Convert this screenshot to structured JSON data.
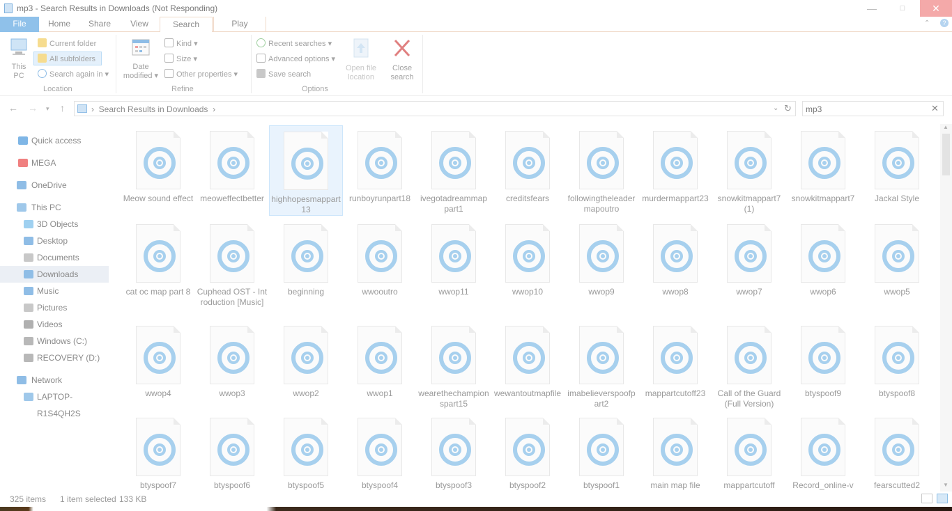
{
  "window": {
    "title": "mp3 - Search Results in Downloads (Not Responding)"
  },
  "tabs": [
    "File",
    "Home",
    "Share",
    "View",
    "Search",
    "Play"
  ],
  "ribbon": {
    "location": {
      "label": "Location",
      "this_pc": [
        "This",
        "PC"
      ],
      "current_folder": "Current folder",
      "all_subfolders": "All subfolders",
      "search_again": "Search again in"
    },
    "refine": {
      "label": "Refine",
      "date_modified": [
        "Date",
        "modified"
      ],
      "kind": "Kind",
      "size": "Size",
      "other_properties": "Other properties"
    },
    "options": {
      "label": "Options",
      "recent_searches": "Recent searches",
      "advanced_options": "Advanced options",
      "save_search": "Save search",
      "open_file_location": [
        "Open file",
        "location"
      ],
      "close_search": [
        "Close",
        "search"
      ]
    }
  },
  "address": {
    "breadcrumb": "Search Results in Downloads",
    "search_value": "mp3"
  },
  "sidebar": {
    "items": [
      {
        "label": "Quick access",
        "icon": "star-icon",
        "color": "#7fb6e6"
      },
      {
        "label": "MEGA",
        "icon": "mega-icon",
        "color": "#f08080"
      },
      {
        "label": "OneDrive",
        "icon": "cloud-icon",
        "color": "#8fbde6"
      },
      {
        "label": "This PC",
        "icon": "computer-icon",
        "color": "#9fc8ea"
      },
      {
        "label": "3D Objects",
        "icon": "cube-icon",
        "color": "#9fd0f0"
      },
      {
        "label": "Desktop",
        "icon": "desktop-icon",
        "color": "#8fbde6"
      },
      {
        "label": "Documents",
        "icon": "documents-icon",
        "color": "#c8c8c8"
      },
      {
        "label": "Downloads",
        "icon": "download-icon",
        "color": "#8fbde6"
      },
      {
        "label": "Music",
        "icon": "music-icon",
        "color": "#8fbde6"
      },
      {
        "label": "Pictures",
        "icon": "pictures-icon",
        "color": "#c8c8c8"
      },
      {
        "label": "Videos",
        "icon": "videos-icon",
        "color": "#b0b0b0"
      },
      {
        "label": "Windows (C:)",
        "icon": "drive-icon",
        "color": "#b8b8b8"
      },
      {
        "label": "RECOVERY (D:)",
        "icon": "drive-icon",
        "color": "#b8b8b8"
      },
      {
        "label": "Network",
        "icon": "network-icon",
        "color": "#8fbde6"
      },
      {
        "label": "LAPTOP-R1S4QH2S",
        "icon": "computer-icon",
        "color": "#9fc8ea"
      }
    ]
  },
  "files": [
    [
      "Meow sound effect",
      "meoweffectbetter",
      "highhopesmappart13",
      "runboyrunpart18",
      "ivegotadreammappart1",
      "creditsfears",
      "followingtheleadermapoutro",
      "murdermappart23",
      "snowkitmappart7 (1)",
      "snowkitmappart7",
      "Jackal Style"
    ],
    [
      "cat oc map part 8",
      "Cuphead OST - Introduction [Music]",
      "beginning",
      "wwooutro",
      "wwop11",
      "wwop10",
      "wwop9",
      "wwop8",
      "wwop7",
      "wwop6",
      "wwop5"
    ],
    [
      "wwop4",
      "wwop3",
      "wwop2",
      "wwop1",
      "wearethechampionspart15",
      "wewantoutmapfile",
      "imabelieverspoofpart2",
      "mappartcutoff23",
      "Call of the Guard (Full Version)",
      "btyspoof9",
      "btyspoof8"
    ],
    [
      "btyspoof7",
      "btyspoof6",
      "btyspoof5",
      "btyspoof4",
      "btyspoof3",
      "btyspoof2",
      "btyspoof1",
      "main map file",
      "mappartcutoff",
      "Record_online-v",
      "fearscutted2"
    ]
  ],
  "status": {
    "count": "325 items",
    "selected": "1 item selected",
    "size": "133 KB"
  },
  "colors": {
    "accent": "#8fc1ea",
    "selection": "#e9f3fd",
    "close": "#f4a9a9",
    "music_icon": "#a7d0ee"
  }
}
